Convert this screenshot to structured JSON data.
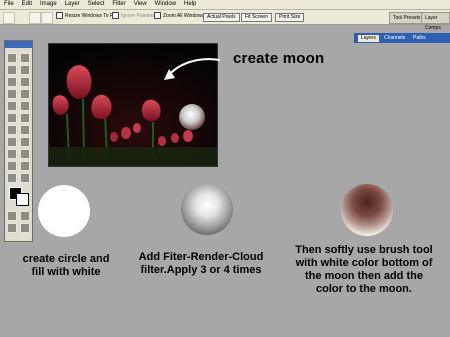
{
  "menu": [
    "File",
    "Edit",
    "Image",
    "Layer",
    "Select",
    "Filter",
    "View",
    "Window",
    "Help"
  ],
  "options": {
    "resize_windows_to_fit": "Resize Windows To Fit",
    "ignore_palettes": "Ignore Palettes",
    "zoom_all_windows": "Zoom All Windows",
    "actual_pixels": "Actual Pixels",
    "fit_screen": "Fit Screen",
    "print_size": "Print Size"
  },
  "palette_well": {
    "tool_presets": "Tool Presets",
    "layer_comps": "Layer Comps"
  },
  "layers_panel": {
    "tabs": [
      "Layers",
      "Channels",
      "Paths"
    ]
  },
  "main": {
    "title": "create moon",
    "captions": {
      "step1": "create circle and fill with white",
      "step2": "Add Fiter-Render-Cloud filter.Apply 3 or 4 times",
      "step3": "Then softly use brush tool with white color bottom of the moon then add the color to the moon."
    }
  },
  "colors": {
    "background": "#a7a7a7",
    "toolbar": "#ece9d8",
    "accent": "#2f5fb3"
  }
}
